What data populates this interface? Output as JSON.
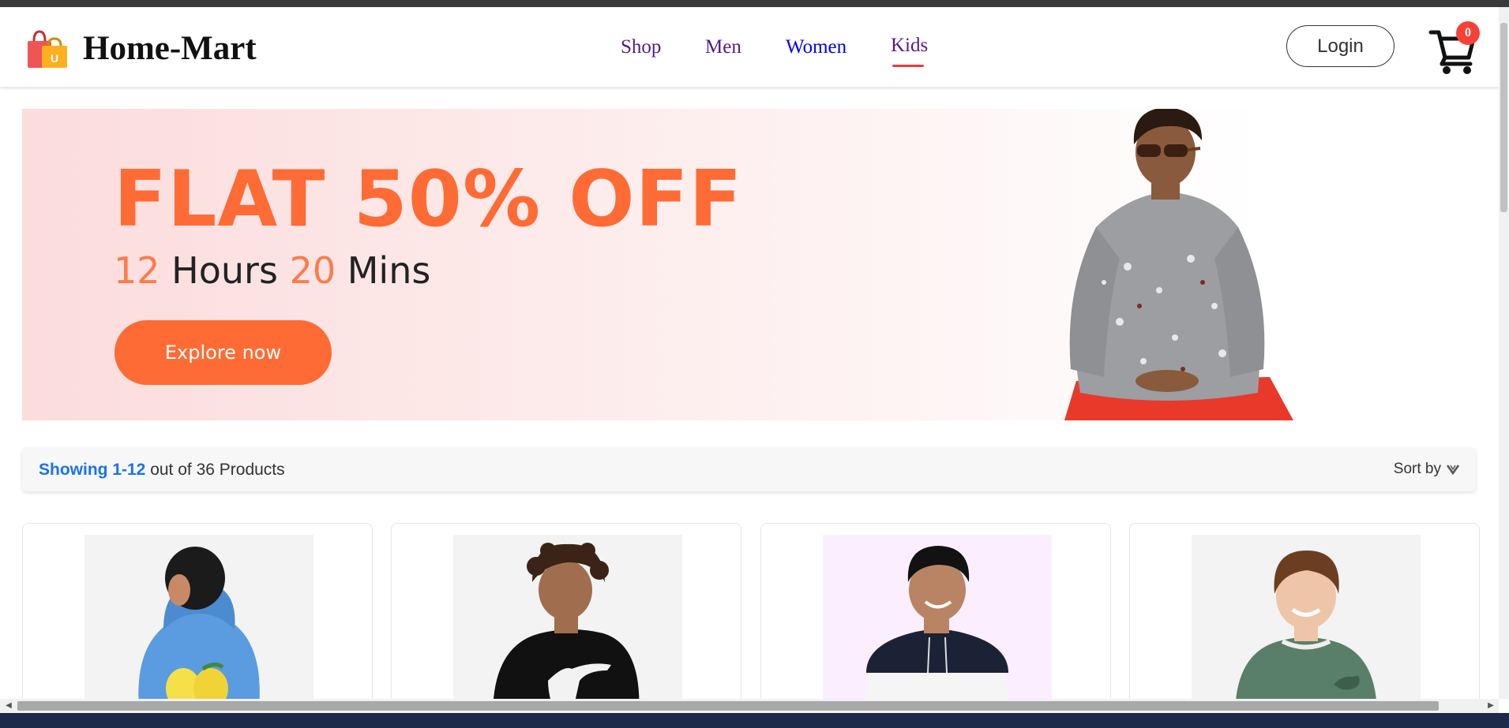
{
  "header": {
    "brand": "Home-Mart",
    "logo_badge": "U",
    "nav": [
      "Shop",
      "Men",
      "Women",
      "Kids"
    ],
    "active_nav": "Kids",
    "login_label": "Login",
    "cart_count": "0"
  },
  "banner": {
    "headline": "FLAT 50% OFF",
    "hours_value": "12",
    "hours_label": "Hours",
    "mins_value": "20",
    "mins_label": "Mins",
    "cta_label": "Explore now"
  },
  "results": {
    "range_label": "Showing 1-12",
    "total_label": "out of 36 Products",
    "sort_label": "Sort by"
  },
  "products": [
    {
      "name": "boy-blue-hoodie"
    },
    {
      "name": "boy-black-hoodie"
    },
    {
      "name": "boy-navy-white-hoodie"
    },
    {
      "name": "boy-green-sweatshirt"
    }
  ],
  "colors": {
    "accent": "#ff6b35",
    "link_blue": "#1a73e8",
    "badge_red": "#f44336",
    "active_underline": "#ef3b3b"
  }
}
